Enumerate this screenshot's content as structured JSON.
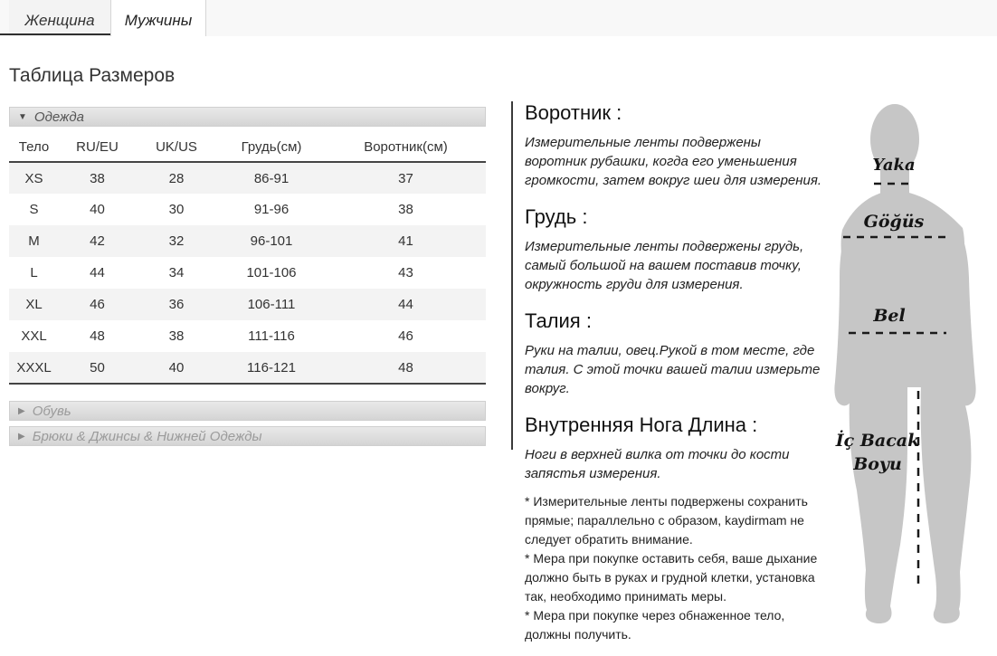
{
  "tabs": {
    "women": "Женщина",
    "men": "Мужчины"
  },
  "page_title": "Таблица Размеров",
  "accordion": {
    "clothing_label": "Одежда",
    "clothing_arrow": "▼",
    "shoes_label": "Обувь",
    "shoes_arrow": "▶",
    "pants_label": "Брюки & Джинсы & Нижней Одежды",
    "pants_arrow": "▶"
  },
  "size_table": {
    "columns": [
      "Тело",
      "RU/EU",
      "UK/US",
      "Грудь(см)",
      "Воротник(см)"
    ],
    "rows": [
      [
        "XS",
        "38",
        "28",
        "86-91",
        "37"
      ],
      [
        "S",
        "40",
        "30",
        "91-96",
        "38"
      ],
      [
        "M",
        "42",
        "32",
        "96-101",
        "41"
      ],
      [
        "L",
        "44",
        "34",
        "101-106",
        "43"
      ],
      [
        "XL",
        "46",
        "36",
        "106-111",
        "44"
      ],
      [
        "XXL",
        "48",
        "38",
        "111-116",
        "46"
      ],
      [
        "XXXL",
        "50",
        "40",
        "116-121",
        "48"
      ]
    ]
  },
  "sections": [
    {
      "heading": "Воротник :",
      "body": "Измерительные ленты подвержены воротник рубашки, когда его уменьшения громкости, затем вокруг шеи для измерения."
    },
    {
      "heading": "Грудь :",
      "body": "Измерительные ленты подвержены грудь, самый большой на вашем поставив точку, окружность груди для измерения."
    },
    {
      "heading": "Талия :",
      "body": "Руки на талии, овец.Рукой в том месте, где талия. С этой точки вашей талии измерьте вокруг."
    },
    {
      "heading": "Внутренняя Нога Длина :",
      "body": "Ноги в верхней вилка от точки до кости запястья измерения."
    }
  ],
  "footnotes": [
    "* Измерительные ленты подвержены сохранить прямые; параллельно с образом, kaydirmam не следует обратить внимание.",
    "* Мера при покупке оставить себя, ваше дыхание должно быть в руках и грудной клетки, установка так, необходимо принимать меры.",
    "* Мера при покупке через обнаженное тело, должны получить."
  ],
  "figure_labels": {
    "neck": "Yaka",
    "chest": "Göğüs",
    "waist": "Bel",
    "inseam_line1": "İç Bacak",
    "inseam_line2": "Boyu"
  },
  "colors": {
    "tab_underline": "#2f2f2f",
    "table_border": "#444444",
    "row_shade": "#f3f3f3",
    "silhouette": "#c6c6c6",
    "dash_line": "#1a1a1a"
  }
}
